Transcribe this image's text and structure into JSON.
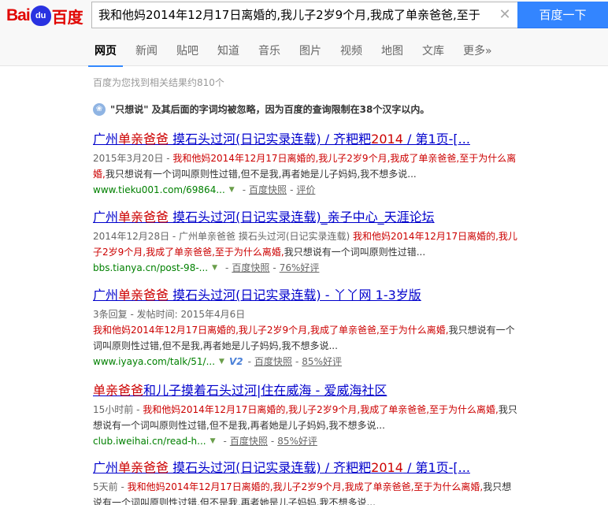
{
  "logo": {
    "bai": "Bai",
    "paw": "du",
    "cn": "百度"
  },
  "search": {
    "query": "我和他妈2014年12月17日离婚的,我儿子2岁9个月,我成了单亲爸爸,至于",
    "clear": "✕",
    "button": "百度一下"
  },
  "nav": [
    "网页",
    "新闻",
    "贴吧",
    "知道",
    "音乐",
    "图片",
    "视频",
    "地图",
    "文库",
    "更多»"
  ],
  "stats": "百度为您找到相关结果约810个",
  "notice": "\"只想说\" 及其后面的字词均被忽略，因为百度的查询限制在38个汉字以内。",
  "results": [
    {
      "title_pre": "广州",
      "title_em": "单亲爸爸",
      "title_mid": " 摸石头过河(日记实录连载) / 齐粑粑",
      "title_em2": "2014",
      "title_post": " / 第1页-[...",
      "date": "2015年3月20日 - ",
      "abs_em": "我和他妈2014年12月17日离婚的,我儿子2岁9个月,我成了单亲爸爸,至于为什么离婚,",
      "abs_post": "我只想说有一个词叫原则性过错,但不是我,再者她是儿子妈妈,我不想多说...",
      "url": "www.tieku001.com/69864...",
      "v2": "",
      "snap": "百度快照",
      "extra": "评价"
    },
    {
      "title_pre": "广州",
      "title_em": "单亲爸爸",
      "title_mid": " 摸石头过河(日记实录连载)_亲子中心_天涯论坛",
      "title_em2": "",
      "title_post": "",
      "date": "2014年12月28日 - 广州单亲爸爸 摸石头过河(日记实录连载) ",
      "abs_em": "我和他妈2014年12月17日离婚的,我儿子2岁9个月,我成了单亲爸爸,至于为什么离婚,",
      "abs_post": "我只想说有一个词叫原则性过错...",
      "url": "bbs.tianya.cn/post-98-...",
      "v2": "",
      "snap": "百度快照",
      "extra": "76%好评"
    },
    {
      "title_pre": "广州",
      "title_em": "单亲爸爸",
      "title_mid": " 摸石头过河(日记实录连载) - 丫丫网 1-3岁版",
      "title_em2": "",
      "title_post": "",
      "date": "3条回复 - 发帖时间: 2015年4月6日",
      "abs_em": "我和他妈2014年12月17日离婚的,我儿子2岁9个月,我成了单亲爸爸,至于为什么离婚,",
      "abs_post": "我只想说有一个词叫原则性过错,但不是我,再者她是儿子妈妈,我不想多说...",
      "url": "www.iyaya.com/talk/51/...",
      "v2": "V2",
      "snap": "百度快照",
      "extra": "85%好评"
    },
    {
      "title_pre": "",
      "title_em": "单亲爸爸",
      "title_mid": "和儿子摸着石头过河|住在威海 - 爱威海社区",
      "title_em2": "",
      "title_post": "",
      "date": "15小时前 - ",
      "abs_em": "我和他妈2014年12月17日离婚的,我儿子2岁9个月,我成了单亲爸爸,至于为什么离婚,",
      "abs_post": "我只想说有一个词叫原则性过错,但不是我,再者她是儿子妈妈,我不想多说...",
      "url": "club.iweihai.cn/read-h...",
      "v2": "",
      "snap": "百度快照",
      "extra": "85%好评"
    },
    {
      "title_pre": "广州",
      "title_em": "单亲爸爸",
      "title_mid": " 摸石头过河(日记实录连载) / 齐粑粑",
      "title_em2": "2014",
      "title_post": " / 第1页-[...",
      "date": "5天前 - ",
      "abs_em": "我和他妈2014年12月17日离婚的,我儿子2岁9个月,我成了单亲爸爸,至于为什么离婚,",
      "abs_post": "我只想说有一个词叫原则性过错,但不是我,再者她是儿子妈妈,我不想多说...",
      "url": "",
      "v2": "",
      "snap": "",
      "extra": ""
    }
  ]
}
